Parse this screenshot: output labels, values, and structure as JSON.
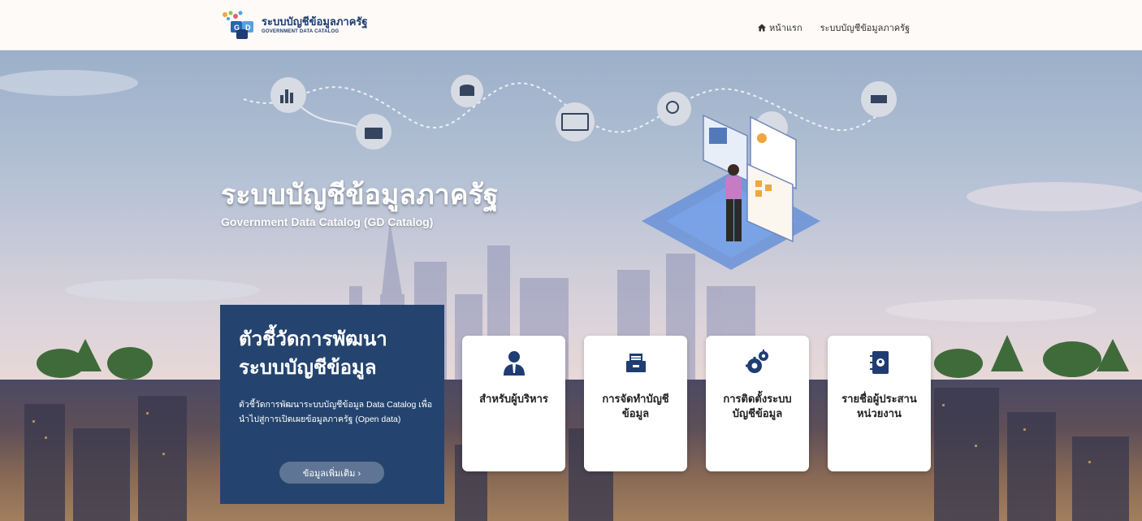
{
  "header": {
    "logo_title": "ระบบบัญชีข้อมูลภาครัฐ",
    "logo_subtitle": "GOVERNMENT DATA CATALOG",
    "nav": {
      "home": "หน้าแรก",
      "catalog": "ระบบบัญชีข้อมูลภาครัฐ"
    }
  },
  "hero": {
    "title": "ระบบบัญชีข้อมูลภาครัฐ",
    "subtitle": "Government Data Catalog (GD Catalog)"
  },
  "panel": {
    "title": "ตัวชี้วัดการพัฒนา ระบบบัญชีข้อมูล",
    "description": "ตัวชี้วัดการพัฒนาระบบบัญชีข้อมูล Data Catalog เพื่อนำไปสู่การเปิดเผยข้อมูลภาครัฐ (Open data)",
    "button": "ข้อมูลเพิ่มเติม ›"
  },
  "cards": [
    {
      "label": "สำหรับผู้บริหาร",
      "icon": "manager-icon"
    },
    {
      "label": "การจัดทำบัญชีข้อมูล",
      "icon": "file-cabinet-icon"
    },
    {
      "label": "การติดตั้งระบบบัญชีข้อมูล",
      "icon": "gears-icon"
    },
    {
      "label": "รายชื่อผู้ประสานหน่วยงาน",
      "icon": "contact-book-icon"
    }
  ],
  "colors": {
    "brand_blue": "#24446f",
    "button_blue": "#5f7595",
    "card_icon": "#1f3c73"
  }
}
